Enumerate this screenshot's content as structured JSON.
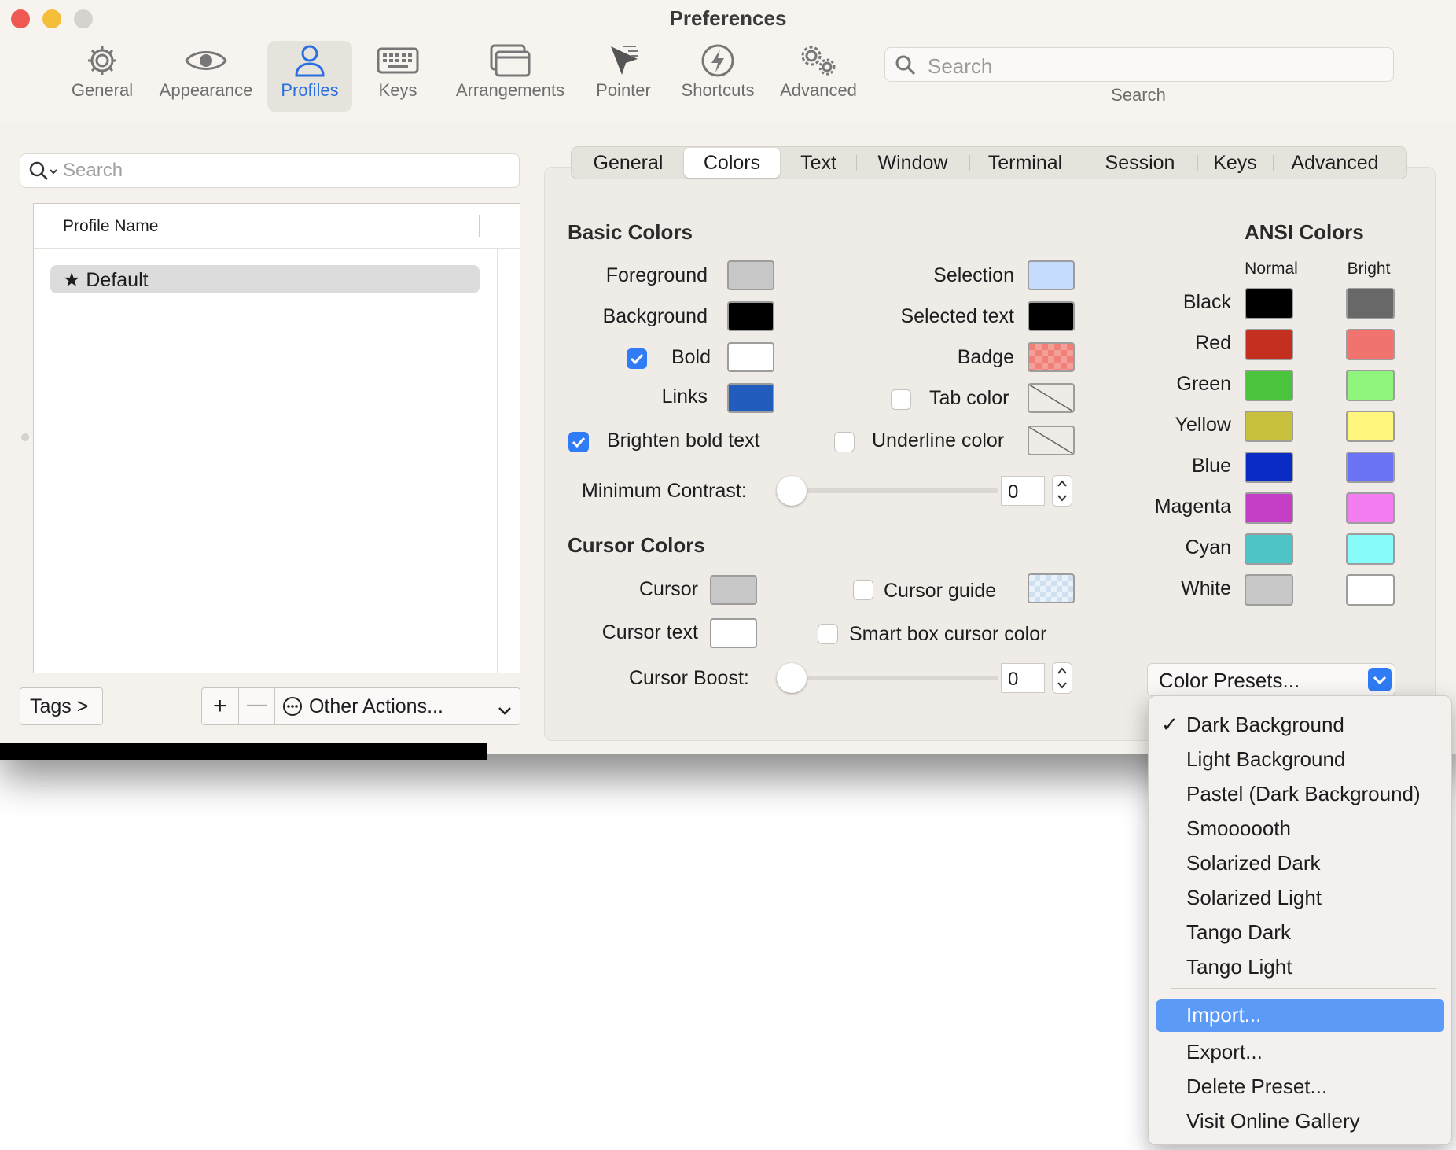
{
  "window": {
    "title": "Preferences"
  },
  "toolbar": {
    "items": [
      {
        "label": "General",
        "icon": "gear-icon"
      },
      {
        "label": "Appearance",
        "icon": "eye-icon"
      },
      {
        "label": "Profiles",
        "icon": "person-icon"
      },
      {
        "label": "Keys",
        "icon": "keyboard-icon"
      },
      {
        "label": "Arrangements",
        "icon": "windows-icon"
      },
      {
        "label": "Pointer",
        "icon": "pointer-icon"
      },
      {
        "label": "Shortcuts",
        "icon": "bolt-icon"
      },
      {
        "label": "Advanced",
        "icon": "gears-icon"
      }
    ],
    "active": "Profiles",
    "search_placeholder": "Search",
    "search_label": "Search"
  },
  "profiles": {
    "search_placeholder": "Search",
    "column_header": "Profile Name",
    "rows": [
      {
        "name": "Default",
        "starred": true
      }
    ],
    "tags_button": "Tags >",
    "add_button": "+",
    "remove_button": "—",
    "other_actions": "Other Actions..."
  },
  "tabs": [
    "General",
    "Colors",
    "Text",
    "Window",
    "Terminal",
    "Session",
    "Keys",
    "Advanced"
  ],
  "active_tab": "Colors",
  "basic_colors": {
    "title": "Basic Colors",
    "foreground": {
      "label": "Foreground",
      "color": "#c7c7c7"
    },
    "background": {
      "label": "Background",
      "color": "#000000"
    },
    "bold": {
      "label": "Bold",
      "color": "#ffffff",
      "checked": true
    },
    "links": {
      "label": "Links",
      "color": "#225cbd"
    },
    "selection": {
      "label": "Selection",
      "color": "#c6dcfc"
    },
    "selected_text": {
      "label": "Selected text",
      "color": "#000000"
    },
    "badge": {
      "label": "Badge",
      "color": "#f08078"
    },
    "tab_color": {
      "label": "Tab color",
      "checked": false
    },
    "underline_color": {
      "label": "Underline color",
      "checked": false
    },
    "brighten_bold": {
      "label": "Brighten bold text",
      "checked": true
    },
    "min_contrast": {
      "label": "Minimum Contrast:",
      "value": "0"
    }
  },
  "cursor_colors": {
    "title": "Cursor Colors",
    "cursor": {
      "label": "Cursor",
      "color": "#c7c7c7"
    },
    "cursor_text": {
      "label": "Cursor text",
      "color": "#ffffff"
    },
    "cursor_guide": {
      "label": "Cursor guide",
      "checked": false,
      "color": "#cfe3f5"
    },
    "smart_box": {
      "label": "Smart box cursor color",
      "checked": false
    },
    "cursor_boost": {
      "label": "Cursor Boost:",
      "value": "0"
    }
  },
  "ansi": {
    "title": "ANSI Colors",
    "normal_label": "Normal",
    "bright_label": "Bright",
    "rows": [
      {
        "name": "Black",
        "normal": "#000000",
        "bright": "#686868"
      },
      {
        "name": "Red",
        "normal": "#c4301f",
        "bright": "#f0736d"
      },
      {
        "name": "Green",
        "normal": "#4ac33d",
        "bright": "#8ff57c"
      },
      {
        "name": "Yellow",
        "normal": "#c8c13d",
        "bright": "#fff77d"
      },
      {
        "name": "Blue",
        "normal": "#0b2bc5",
        "bright": "#6a73f3"
      },
      {
        "name": "Magenta",
        "normal": "#c43ec6",
        "bright": "#f37ef1"
      },
      {
        "name": "Cyan",
        "normal": "#4fc4c7",
        "bright": "#87fafa"
      },
      {
        "name": "White",
        "normal": "#c7c7c7",
        "bright": "#ffffff"
      }
    ]
  },
  "color_presets": {
    "button_label": "Color Presets...",
    "items": [
      {
        "label": "Dark Background",
        "checked": true
      },
      {
        "label": "Light Background"
      },
      {
        "label": "Pastel (Dark Background)"
      },
      {
        "label": "Smoooooth"
      },
      {
        "label": "Solarized Dark"
      },
      {
        "label": "Solarized Light"
      },
      {
        "label": "Tango Dark"
      },
      {
        "label": "Tango Light"
      }
    ],
    "actions": [
      {
        "label": "Import...",
        "highlighted": true
      },
      {
        "label": "Export..."
      },
      {
        "label": "Delete Preset..."
      },
      {
        "label": "Visit Online Gallery"
      }
    ]
  },
  "accent_color": "#2f7cf6"
}
